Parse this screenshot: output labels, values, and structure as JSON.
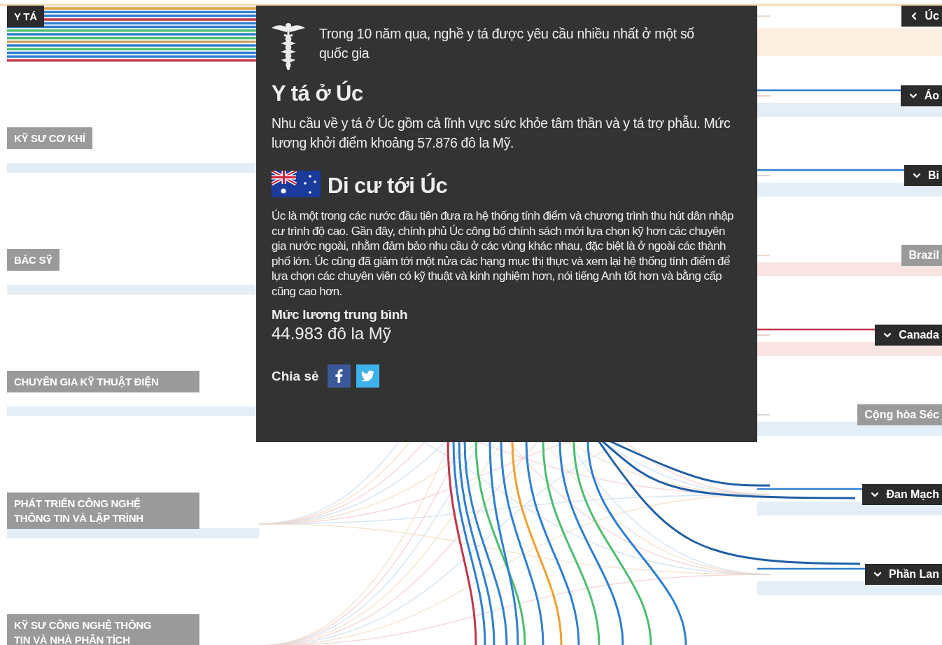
{
  "jobs": [
    {
      "label": "Y TÁ",
      "selected": true
    },
    {
      "label": "KỸ SƯ CƠ KHÍ",
      "selected": false
    },
    {
      "label": "BÁC SỸ",
      "selected": false
    },
    {
      "label": "CHUYÊN GIA KỸ THUẬT ĐIỆN",
      "selected": false
    },
    {
      "label": "PHÁT TRIỂN CÔNG NGHỆ THÔNG TIN VÀ LẬP TRÌNH",
      "selected": false
    },
    {
      "label": "KỸ SƯ CÔNG NGHỆ THÔNG TIN VÀ NHÀ PHÂN TÍCH",
      "selected": false
    }
  ],
  "countries": [
    {
      "label": "Úc",
      "kind": "open"
    },
    {
      "label": "Áo",
      "kind": "expandable"
    },
    {
      "label": "Bỉ",
      "kind": "expandable"
    },
    {
      "label": "Brazil",
      "kind": "plain"
    },
    {
      "label": "Canada",
      "kind": "expandable"
    },
    {
      "label": "Cộng hòa Séc",
      "kind": "plain"
    },
    {
      "label": "Đan Mạch",
      "kind": "expandable"
    },
    {
      "label": "Phần Lan",
      "kind": "expandable"
    }
  ],
  "popup": {
    "intro": "Trong 10 năm qua, nghề y tá được yêu cầu nhiều nhất ở một số quốc gia",
    "title": "Y tá ở Úc",
    "description": "Nhu cầu về y tá ở Úc gồm cả lĩnh vực sức khỏe tâm thần và y tá trợ phẫu. Mức lương khởi điểm khoảng 57.876 đô la Mỹ.",
    "migration_title": "Di cư tới Úc",
    "migration_text": "Úc là một trong các nước đầu tiên đưa ra hệ thống tính điểm và chương trình thu hút dân nhập cư trình độ cao. Gần đây, chính phủ Úc công bố chính sách mới lựa chọn kỹ hơn các chuyên gia nước ngoài, nhằm đảm bảo nhu cầu ở các vùng khác nhau, đặc biệt là ở ngoài các thành phố lớn. Úc cũng đã giảm tới một nửa các hạng mục thị thực và xem lại hệ thống tính điểm để lựa chọn các chuyên viên có kỹ thuật và kinh nghiệm hơn, nói tiếng Anh tốt hơn và bằng cấp cũng cao hơn.",
    "salary_label": "Mức lương trung bình",
    "salary_value": "44.983 đô la Mỹ",
    "share_label": "Chia sẻ"
  }
}
